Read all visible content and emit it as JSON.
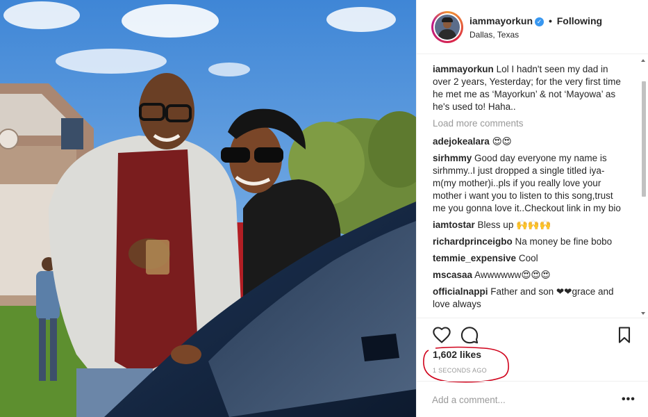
{
  "post": {
    "photo_alt": "father and son photo",
    "header": {
      "username": "iammayorkun",
      "verified_icon": "verified-badge-icon",
      "separator": "•",
      "follow_state": "Following",
      "location": "Dallas, Texas"
    },
    "caption": {
      "username": "iammayorkun",
      "text": "Lol I hadn't seen my dad in over 2 years, Yesterday; for the very first time he met me as ‘Mayorkun’ & not ‘Mayowa’ as he's used to! Haha.."
    },
    "load_more_label": "Load more comments",
    "comments": [
      {
        "username": "adejokealara",
        "text": "😍😍"
      },
      {
        "username": "sirhmmy",
        "text": "Good day everyone my name is sirhmmy..I just dropped a single titled iya-m(my mother)i..pls if you really love your mother i want you to listen to this song,trust me you gonna love it..Checkout link in my bio"
      },
      {
        "username": "iamtostar",
        "text": "Bless up 🙌🙌🙌"
      },
      {
        "username": "richardprinceigbo",
        "text": "Na money be fine bobo"
      },
      {
        "username": "temmie_expensive",
        "text": "Cool"
      },
      {
        "username": "mscasaa",
        "text": "Awwwwww😍😍😍"
      },
      {
        "username": "officialnappi",
        "text": "Father and son ❤❤grace and love always"
      }
    ],
    "actions": {
      "like_icon": "heart-icon",
      "comment_icon": "comment-bubble-icon",
      "save_icon": "bookmark-icon"
    },
    "likes_text": "1,602 likes",
    "timestamp": "1 SECONDS AGO",
    "add_comment_placeholder": "Add a comment...",
    "more_options": "•••",
    "colors": {
      "verified": "#3897f0",
      "annotation": "#d0021b",
      "muted_text": "#999999",
      "border": "#efefef"
    }
  }
}
